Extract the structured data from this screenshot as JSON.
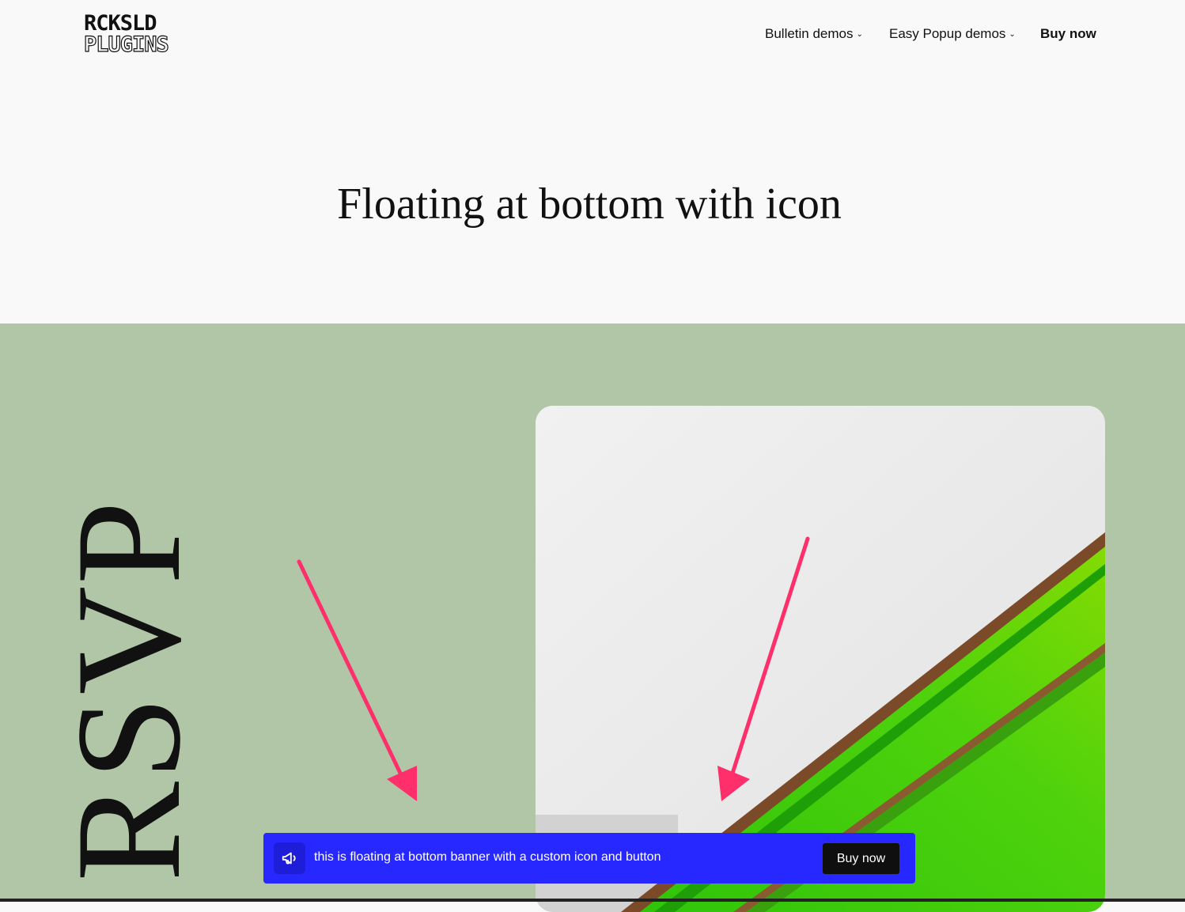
{
  "header": {
    "logo_line1": "RCKSLD",
    "logo_line2": "PLUGINS",
    "nav": {
      "bulletin": "Bulletin demos",
      "easy_popup": "Easy Popup demos",
      "buy": "Buy now"
    }
  },
  "page": {
    "title": "Floating at bottom with icon"
  },
  "hero": {
    "rsvp": "RSVP"
  },
  "banner": {
    "text": "this is floating at bottom banner with a custom icon and button",
    "button": "Buy now",
    "icon": "megaphone-icon"
  },
  "colors": {
    "background": "#f9f9f9",
    "section": "#b1c6a7",
    "banner": "#2727ff",
    "arrow": "#ff2f6b",
    "button": "#0f0f0f"
  }
}
